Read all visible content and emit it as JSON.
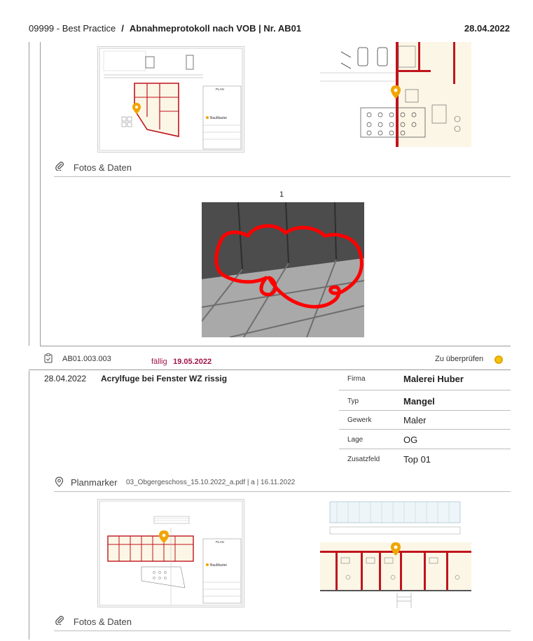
{
  "header": {
    "project": "09999 - Best Practice",
    "separator": "/",
    "title": "Abnahmeprotokoll nach VOB | Nr. AB01",
    "date": "28.04.2022"
  },
  "section1": {
    "plan_title": "PLAN",
    "plan_brand": "BauMaster",
    "photos_label": "Fotos & Daten",
    "photo_number": "1"
  },
  "item": {
    "id": "AB01.003.003",
    "due_label": "fällig",
    "due_date": "19.05.2022",
    "status": "Zu überprüfen",
    "status_color": "#f4c20d",
    "date": "28.04.2022",
    "title": "Acrylfuge bei Fenster WZ rissig",
    "fields": [
      {
        "label": "Firma",
        "value": "Malerei Huber"
      },
      {
        "label": "Typ",
        "value": "Mangel"
      },
      {
        "label": "Gewerk",
        "value": "Maler"
      },
      {
        "label": "Lage",
        "value": "OG"
      },
      {
        "label": "Zusatzfeld",
        "value": "Top 01"
      }
    ],
    "planmarker_label": "Planmarker",
    "planmarker_file": "03_Obgergeschoss_15.10.2022_a.pdf | a | 16.11.2022",
    "plan_title": "PLAN",
    "plan_brand": "BauMaster",
    "photos_label": "Fotos & Daten"
  },
  "colors": {
    "accent_due": "#a0124a",
    "marker": "#f0a500",
    "wall": "#c0141c"
  }
}
